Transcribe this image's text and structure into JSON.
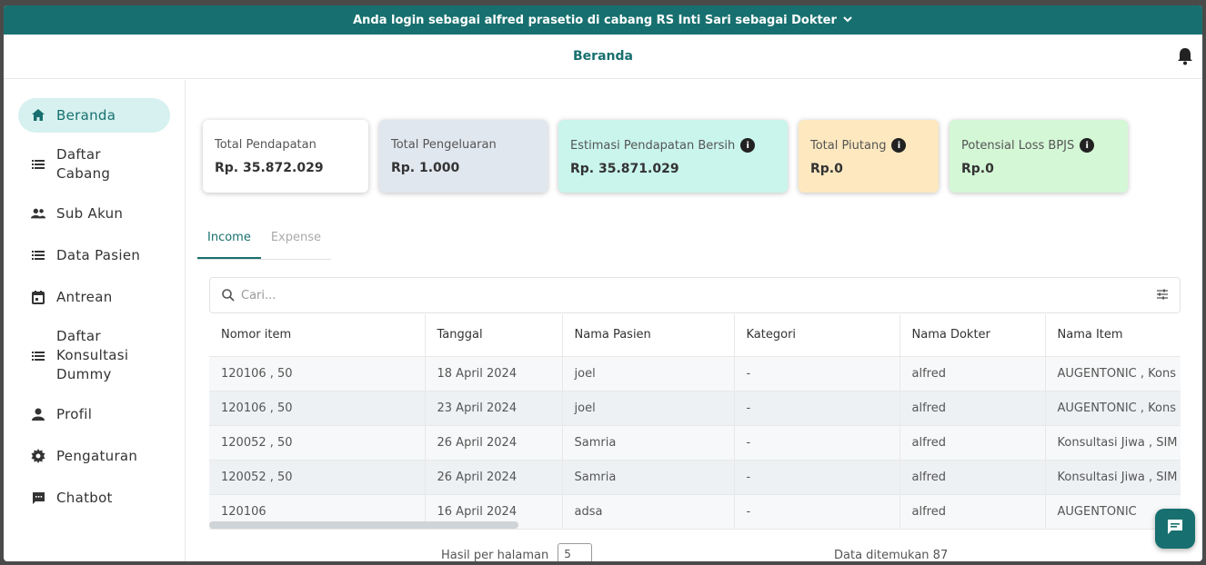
{
  "topbar": {
    "text": "Anda login sebagai alfred prasetio di cabang RS Inti Sari sebagai Dokter",
    "chevron": "chevron-down-icon"
  },
  "header": {
    "title": "Beranda",
    "bell_icon": "bell-icon"
  },
  "sidebar": {
    "items": [
      {
        "label": "Beranda",
        "icon": "home-icon",
        "active": true
      },
      {
        "label": "Daftar Cabang",
        "icon": "list-icon"
      },
      {
        "label": "Sub Akun",
        "icon": "people-icon"
      },
      {
        "label": "Data Pasien",
        "icon": "list-icon"
      },
      {
        "label": "Antrean",
        "icon": "calendar-icon"
      },
      {
        "label": "Daftar Konsultasi Dummy",
        "icon": "list-icon"
      },
      {
        "label": "Profil",
        "icon": "person-icon"
      },
      {
        "label": "Pengaturan",
        "icon": "gear-icon"
      },
      {
        "label": "Chatbot",
        "icon": "chat-icon"
      }
    ]
  },
  "cards": [
    {
      "label": "Total Pendapatan",
      "value": "Rp. 35.872.029",
      "color": "#ffffff",
      "info": false
    },
    {
      "label": "Total Pengeluaran",
      "value": "Rp. 1.000",
      "color": "#e1e7ef",
      "info": false
    },
    {
      "label": "Estimasi Pendapatan Bersih",
      "value": "Rp. 35.871.029",
      "color": "#c9f5ec",
      "info": true
    },
    {
      "label": "Total Piutang",
      "value": "Rp.0",
      "color": "#fde8bf",
      "info": true
    },
    {
      "label": "Potensial Loss BPJS",
      "value": "Rp.0",
      "color": "#d4f7d6",
      "info": true
    }
  ],
  "tabs": [
    {
      "label": "Income",
      "active": true
    },
    {
      "label": "Expense",
      "active": false
    }
  ],
  "search": {
    "placeholder": "Cari..."
  },
  "table": {
    "columns": [
      "Nomor item",
      "Tanggal",
      "Nama Pasien",
      "Kategori",
      "Nama Dokter",
      "Nama Item"
    ],
    "rows": [
      [
        "120106 , 50",
        "18 April 2024",
        "joel",
        "-",
        "alfred",
        "AUGENTONIC , Kons"
      ],
      [
        "120106 , 50",
        "23 April 2024",
        "joel",
        "-",
        "alfred",
        "AUGENTONIC , Kons"
      ],
      [
        "120052 , 50",
        "26 April 2024",
        "Samria",
        "-",
        "alfred",
        "Konsultasi Jiwa , SIM"
      ],
      [
        "120052 , 50",
        "26 April 2024",
        "Samria",
        "-",
        "alfred",
        "Konsultasi Jiwa , SIM"
      ],
      [
        "120106",
        "16 April 2024",
        "adsa",
        "-",
        "alfred",
        "AUGENTONIC"
      ]
    ]
  },
  "pager": {
    "label": "Hasil per halaman",
    "size": "5",
    "found": "Data ditemukan 87"
  },
  "colors": {
    "brand": "#17706f",
    "active_nav": "#d6f1ef"
  }
}
